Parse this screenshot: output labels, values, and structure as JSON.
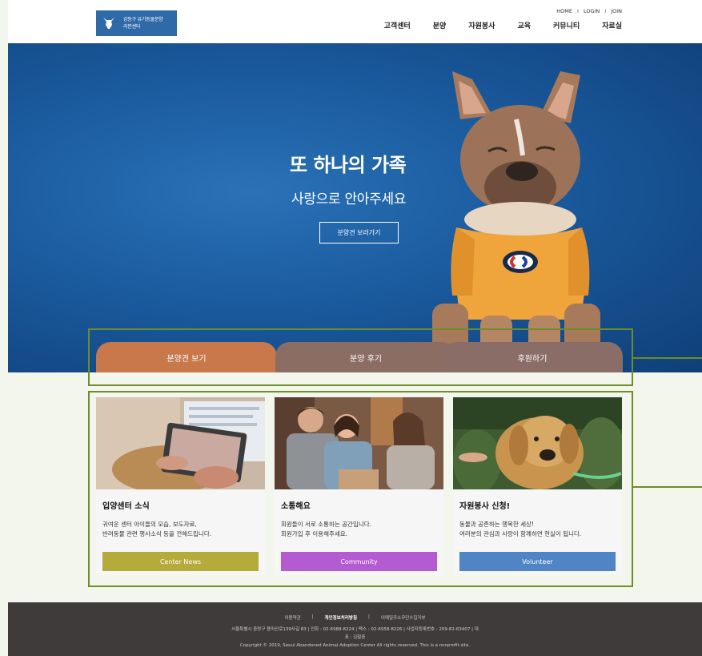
{
  "header": {
    "logo_line1": "강동구 유기동물분양",
    "logo_line2": "리분센터",
    "util": [
      "HOME",
      "LOGIN",
      "JOIN"
    ],
    "nav": [
      "고객센터",
      "분양",
      "자원봉사",
      "교육",
      "커뮤니티",
      "자료실"
    ]
  },
  "hero": {
    "title": "또 하나의 가족",
    "subtitle": "사랑으로 안아주세요",
    "button": "분양견 보러가기"
  },
  "tabs": [
    "분양견 보기",
    "분양 후기",
    "후원하기"
  ],
  "cards": [
    {
      "title": "입양센터 소식",
      "desc_line1": "귀여운 센터 아이들의 모습, 보도자료,",
      "desc_line2": "반려동물 관련 행사소식 등을 전해드립니다.",
      "button": "Center News"
    },
    {
      "title": "소통해요",
      "desc_line1": "회원들이 서로 소통하는 공간입니다.",
      "desc_line2": "회원가입 후 이용해주세요.",
      "button": "Community"
    },
    {
      "title": "자원봉사 신청!",
      "desc_line1": "동물과 공존하는 행복한 세상!",
      "desc_line2": "여러분의 관심과 사랑이 함께하면 현실이 됩니다.",
      "button": "Volunteer"
    }
  ],
  "footer": {
    "links": [
      "이용약관",
      "개인정보처리방침",
      "이메일주소무단수집거부"
    ],
    "address": "서울특별시 중랑구 용마산로139사길 83   |   전화 : 02-6988-8224   |   팩스 : 02-6958-8226   |   사업자등록번호 : 209-82-63407   |   대",
    "address2": "표 : 김철중",
    "copyright": "Copyright © 2019, Seoul Abandoned Animal Adoption Center All rights reserved. This is a nonprofit site."
  },
  "colors": {
    "hero_blue": "#1a5a9d",
    "tab_orange": "#c8784a",
    "tab_brown": "#8c6d64",
    "btn_olive": "#b4ab3a",
    "btn_purple": "#b45bd1",
    "btn_blue": "#4f85c4",
    "outline_green": "#6c8d2a",
    "footer_bg": "#3f3b3b"
  }
}
